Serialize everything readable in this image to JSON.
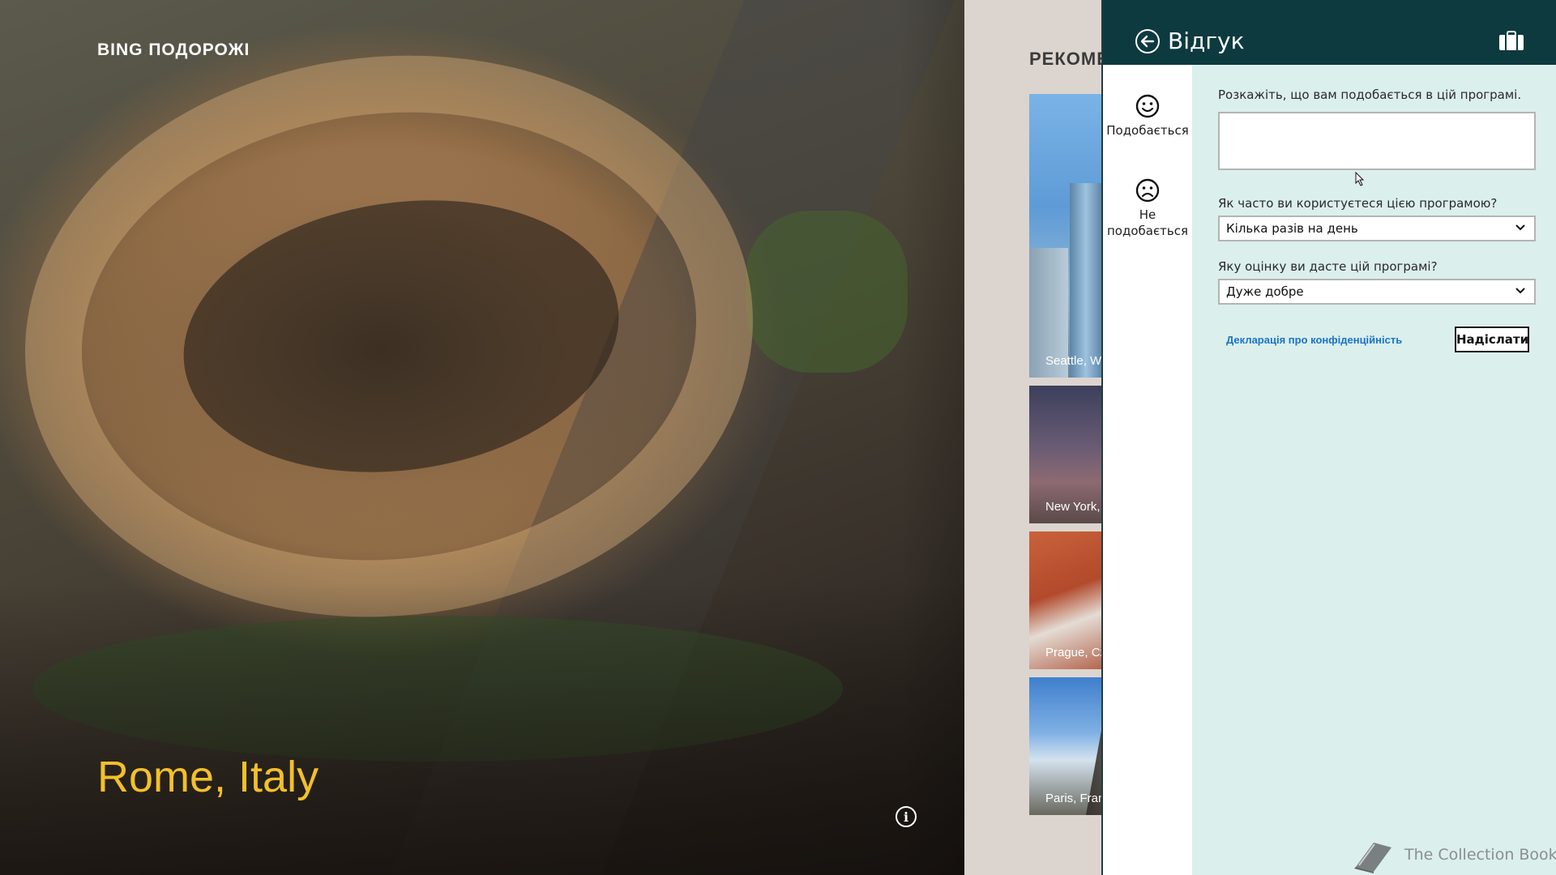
{
  "app": {
    "title": "BING ПОДОРОЖІ"
  },
  "hero": {
    "place_title": "Rome, Italy",
    "info_icon": "info-icon"
  },
  "recommendations": {
    "heading": "РЕКОМЕ",
    "tiles": [
      {
        "label": "Seattle, Wa"
      },
      {
        "label": "New York,"
      },
      {
        "label": "Prague, Cz"
      },
      {
        "label": "Paris, Fran"
      }
    ]
  },
  "feedback_pane": {
    "title": "Відгук",
    "back_icon": "back-arrow-icon",
    "header_icon": "briefcase-icon",
    "tabs": [
      {
        "label": "Подобається",
        "icon": "smile-icon",
        "selected": true
      },
      {
        "label": "Не подобається",
        "icon": "frown-icon",
        "selected": false
      }
    ],
    "prompt_label": "Розкажіть, що вам подобається в цій програмі.",
    "text_value": "",
    "usage_question": "Як часто ви користуєтеся цією програмою?",
    "usage_selected": "Кілька разів на день",
    "rating_question": "Яку оцінку ви дасте цій програмі?",
    "rating_selected": "Дуже добре",
    "privacy_link": "Декларація про конфіденційність",
    "submit_label": "Надіслати"
  },
  "watermark": {
    "text": "The Collection Book"
  },
  "colors": {
    "header_bg": "#0c3a3f",
    "pane_bg": "#dbefec",
    "place_title": "#f2c029",
    "link": "#1a73c8"
  }
}
